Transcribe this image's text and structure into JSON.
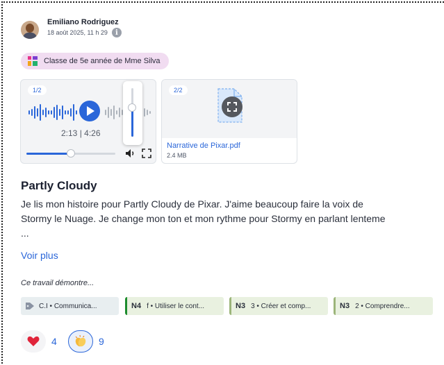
{
  "post": {
    "author_name": "Emiliano Rodriguez",
    "timestamp": "18 août 2025, 11 h 29",
    "info_icon": "i",
    "class_name": "Classe de 5e année de Mme Silva"
  },
  "media": {
    "audio": {
      "counter": "1/2",
      "time_display": "2:13 | 4:26",
      "progress_fraction": 0.5,
      "volume_fraction": 0.6
    },
    "document": {
      "counter": "2/2",
      "file_name": "Narrative de Pixar.pdf",
      "file_size": "2.4 MB"
    }
  },
  "content": {
    "title": "Partly Cloudy",
    "description": "Je lis mon histoire pour Partly Cloudy de Pixar. J'aime beaucoup faire la voix de\nStormy le Nuage. Je change mon ton et mon rythme pour Stormy en parlant lenteme\n...",
    "see_more": "Voir plus"
  },
  "skills": {
    "label": "Ce travail démontre...",
    "tags": [
      {
        "level": "",
        "text": "C.I • Communica..."
      },
      {
        "level": "N4",
        "text": "f • Utiliser le cont..."
      },
      {
        "level": "N3",
        "text": "3 • Créer et comp..."
      },
      {
        "level": "N3",
        "text": "2 • Comprendre..."
      }
    ]
  },
  "reactions": {
    "heart_count": "4",
    "clap_count": "9"
  },
  "colors": {
    "accent": "#2a66d9",
    "class_pill": "#f1dcf1",
    "tag_bg": "#e9f1e0",
    "level_green": "#1d8c2e",
    "level_olive": "#9cb57a"
  }
}
